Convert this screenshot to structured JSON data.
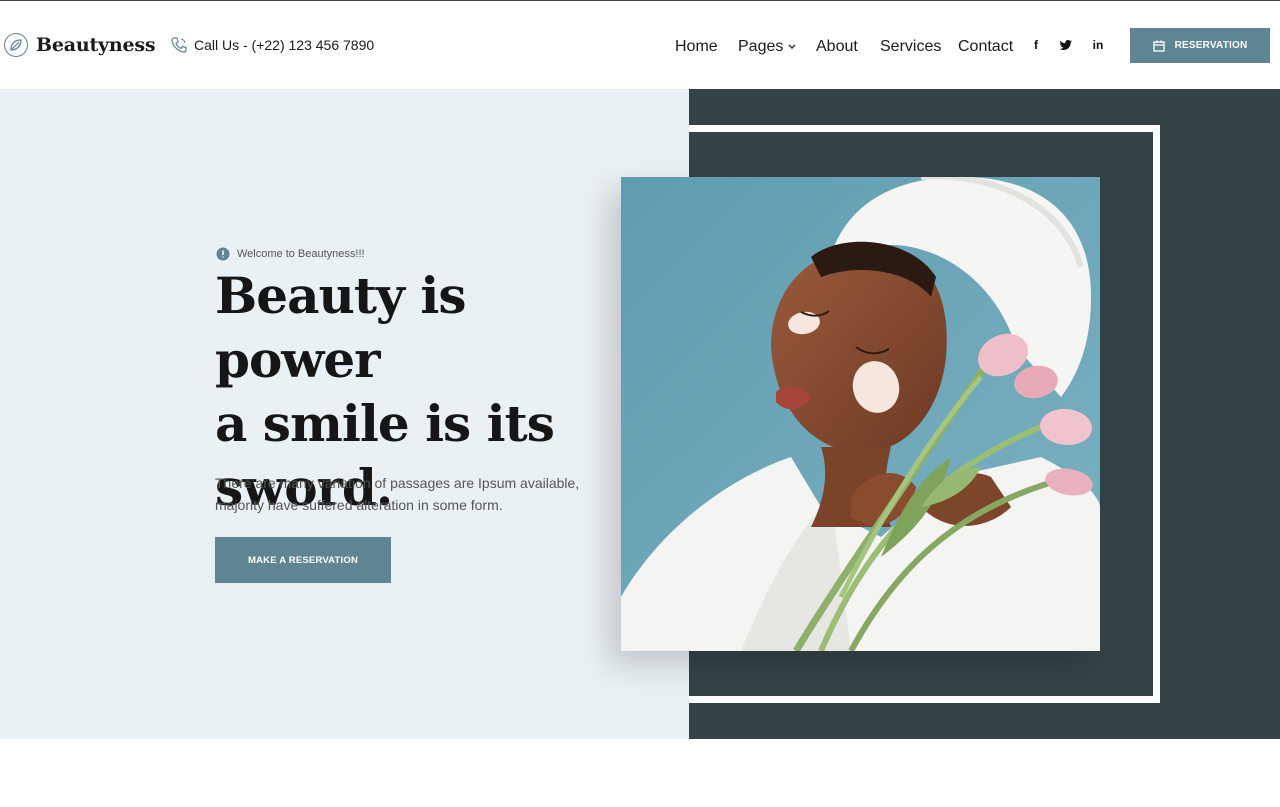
{
  "brand": {
    "name": "Beautyness",
    "icon": "leaf-logo-icon"
  },
  "header": {
    "call_text": "Call Us - (+22) 123 456 7890",
    "call_icon": "phone-icon",
    "nav": [
      {
        "label": "Home"
      },
      {
        "label": "Pages",
        "has_dropdown": true
      },
      {
        "label": "About"
      },
      {
        "label": "Services"
      },
      {
        "label": "Contact"
      }
    ],
    "social": [
      {
        "glyph": "f",
        "icon": "facebook-icon"
      },
      {
        "glyph": "t",
        "icon": "twitter-icon"
      },
      {
        "glyph": "in",
        "icon": "linkedin-icon"
      }
    ],
    "reservation_label": "RESERVATION",
    "reservation_icon": "calendar-icon"
  },
  "hero": {
    "welcome": "Welcome to Beautyness!!!",
    "headline_line1": "Beauty is power",
    "headline_line2": "a smile is its",
    "headline_line3": "sword.",
    "description": "There are many variation of passages are Ipsum available, majority have suffered alteration in some form.",
    "cta_label": "MAKE A RESERVATION",
    "image_subject": "woman with towel on head holding pink tulips"
  },
  "colors": {
    "accent": "#5f8593",
    "hero_bg_light": "#eaf1f4",
    "hero_bg_dark": "#354347",
    "photo_bg": "#6aa3b6"
  }
}
